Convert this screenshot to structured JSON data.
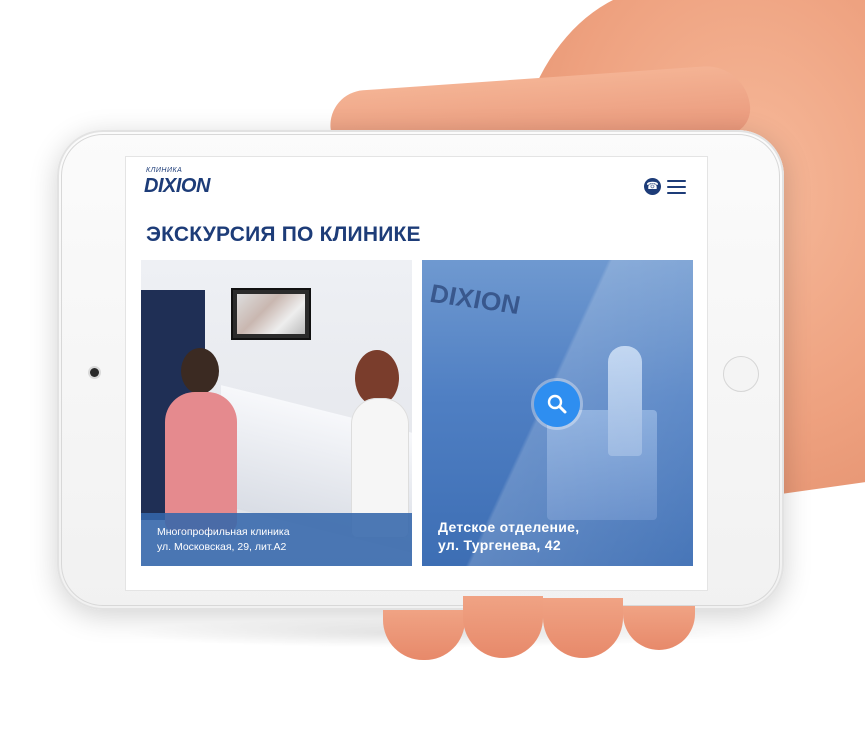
{
  "header": {
    "logo_small": "КЛИНИКА",
    "logo_main": "DIXION"
  },
  "page": {
    "title": "ЭКСКУРСИЯ ПО КЛИНИКЕ"
  },
  "cards": [
    {
      "line1": "Многопрофильная клиника",
      "line2": "ул. Московская, 29, лит.А2"
    },
    {
      "line1": "Детское отделение,",
      "line2": "ул. Тургенева, 42"
    }
  ],
  "colors": {
    "brand": "#1d3c78",
    "caption_blue": "#3467ab",
    "zoom_button": "#2e8ef0"
  },
  "icons": {
    "phone": "phone-icon",
    "menu": "hamburger-menu-icon",
    "zoom": "search-icon"
  }
}
